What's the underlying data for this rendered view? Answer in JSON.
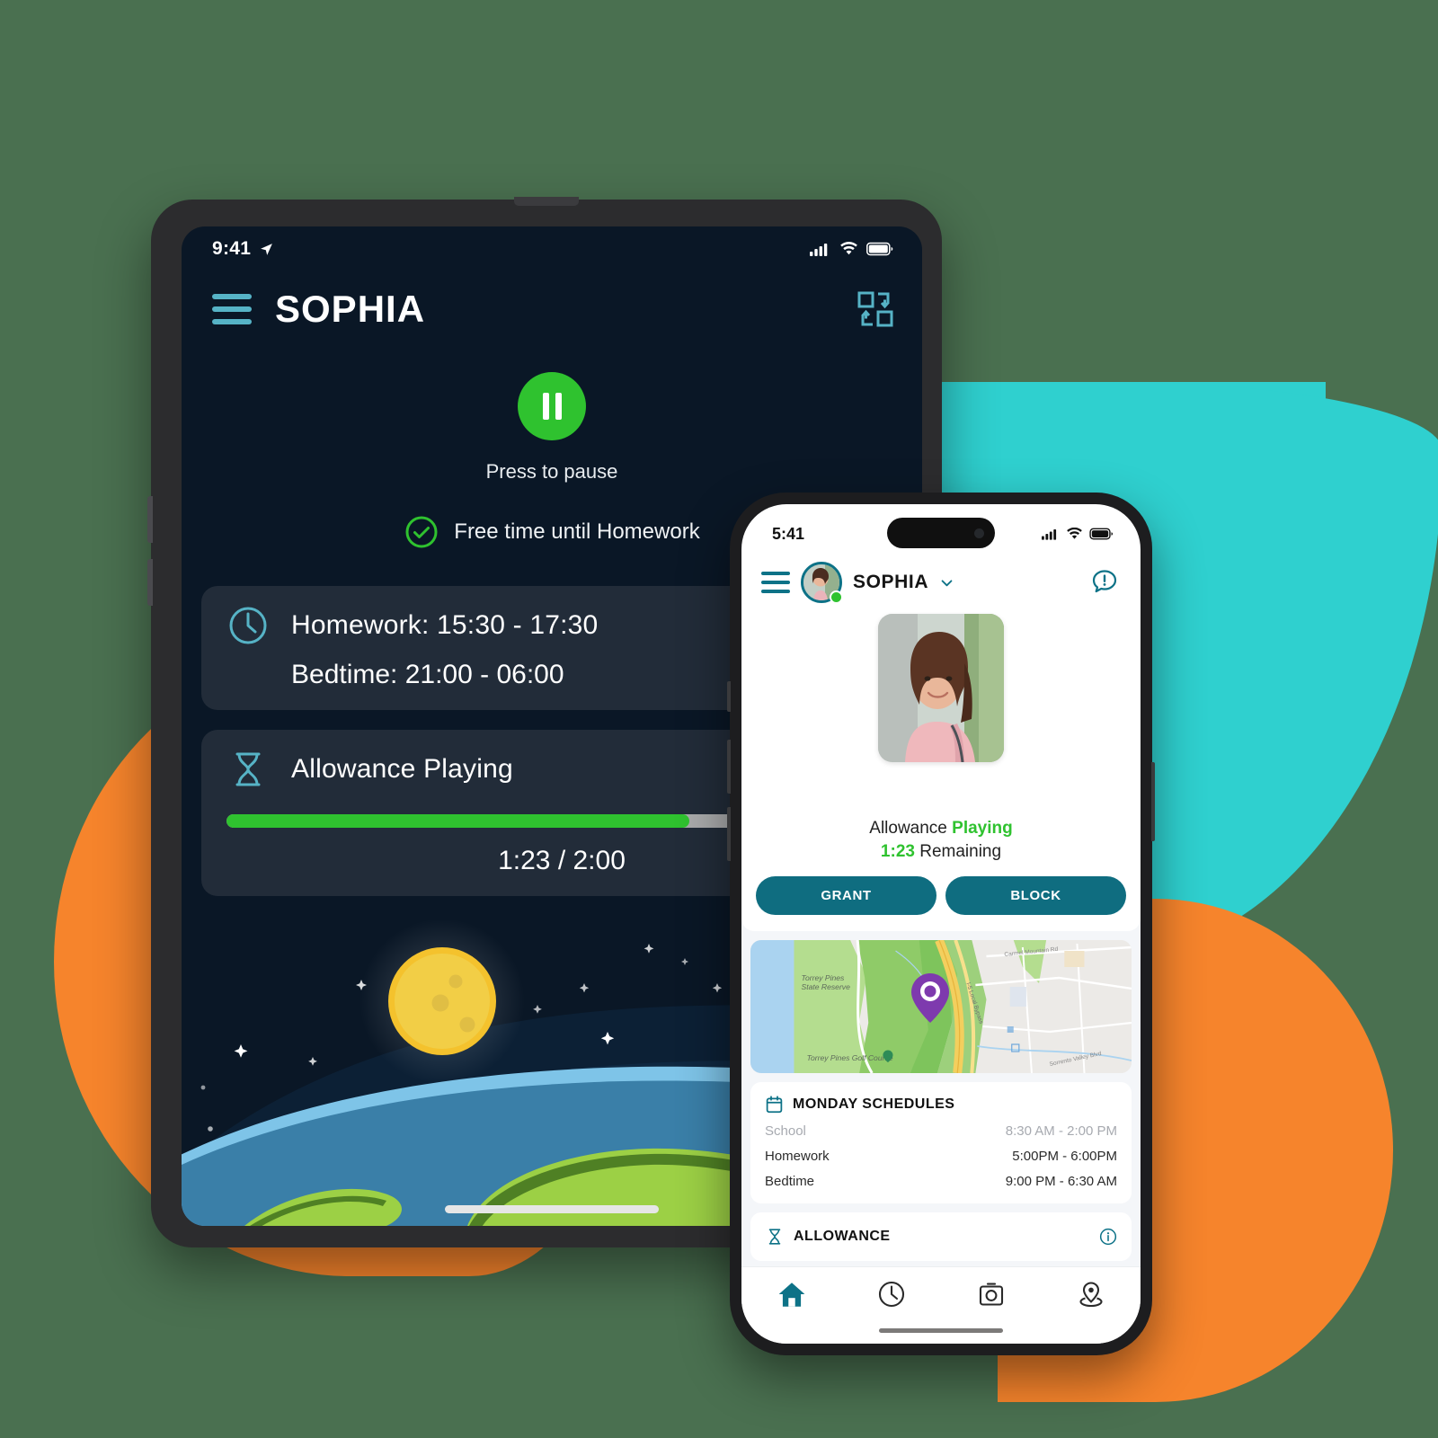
{
  "colors": {
    "page_background": "#4A7050",
    "blob_teal": "#2FD0CF",
    "blob_orange": "#F6842C",
    "tablet_screen_bg": "#0A1726",
    "tablet_card_bg": "#222C39",
    "accent_teal_light": "#56B3C6",
    "accent_teal_dark": "#0F6D80",
    "status_green": "#2FC22F",
    "map_pin_purple": "#7E3AAE"
  },
  "tablet": {
    "status_bar": {
      "time": "9:41",
      "location_icon": "location-arrow-icon",
      "cellular_icon": "cellular-signal-icon",
      "wifi_icon": "wifi-icon",
      "battery_icon": "battery-icon"
    },
    "header": {
      "menu_icon": "hamburger-menu-icon",
      "title": "SOPHIA",
      "switch_icon": "switch-device-icon"
    },
    "hero": {
      "pause_icon": "pause-icon",
      "press_label": "Press to pause",
      "check_icon": "check-circle-icon",
      "freetime_label": "Free time until Homework"
    },
    "schedule_card": {
      "clock_icon": "clock-icon",
      "homework": "Homework: 15:30 - 17:30",
      "bedtime": "Bedtime: 21:00 - 06:00"
    },
    "allowance_card": {
      "hourglass_icon": "hourglass-icon",
      "label": "Allowance  Playing",
      "progress_percent": 69,
      "time": "1:23 / 2:00"
    },
    "illustration": {
      "name": "space-earth-moon-illustration",
      "moon_label": "moon",
      "earth_label": "earth",
      "stars_label": "stars"
    }
  },
  "phone": {
    "status_bar": {
      "time": "5:41",
      "cellular_icon": "cellular-signal-icon",
      "wifi_icon": "wifi-icon",
      "battery_icon": "battery-icon"
    },
    "header": {
      "menu_icon": "hamburger-menu-icon",
      "avatar_icon": "user-avatar",
      "title": "SOPHIA",
      "chevron_icon": "chevron-down-icon",
      "alert_icon": "alert-message-icon"
    },
    "child_card": {
      "photo_label": "child-photo",
      "status_prefix": "Allowance",
      "status_value": "Playing",
      "remaining_value": "1:23",
      "remaining_suffix": "Remaining",
      "grant_label": "GRANT",
      "block_label": "BLOCK"
    },
    "map": {
      "pin_icon": "map-location-pin",
      "labels": [
        "Torrey Pines State Reserve",
        "Torrey Pines Golf Course",
        "Carmel Mountain Rd",
        "I-5 Local Bypass",
        "Sorrento Valley Blvd"
      ]
    },
    "schedules": {
      "calendar_icon": "calendar-icon",
      "title": "MONDAY SCHEDULES",
      "rows": [
        {
          "name": "School",
          "time": "8:30 AM - 2:00 PM",
          "muted": true
        },
        {
          "name": "Homework",
          "time": "5:00PM - 6:00PM",
          "muted": false
        },
        {
          "name": "Bedtime",
          "time": "9:00 PM - 6:30 AM",
          "muted": false
        }
      ]
    },
    "allowance_section": {
      "hourglass_icon": "hourglass-icon",
      "title": "ALLOWANCE",
      "info_icon": "info-icon"
    },
    "tabbar": {
      "items": [
        {
          "icon": "home-icon",
          "active": true
        },
        {
          "icon": "clock-icon",
          "active": false
        },
        {
          "icon": "camera-icon",
          "active": false
        },
        {
          "icon": "location-icon",
          "active": false
        }
      ]
    }
  }
}
